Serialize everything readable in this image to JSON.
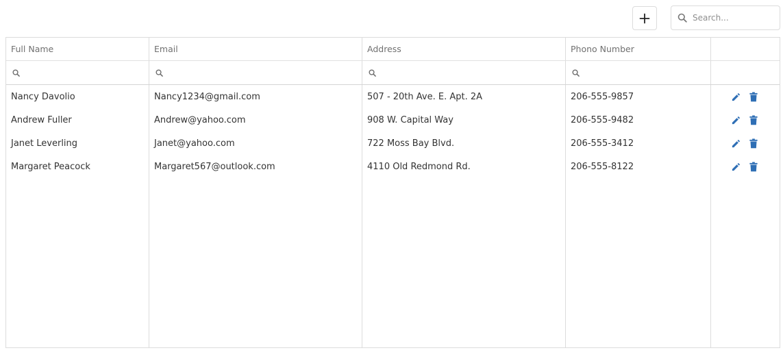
{
  "toolbar": {
    "add_icon": "plus-icon",
    "search_icon": "search-icon",
    "search_placeholder": "Search..."
  },
  "grid": {
    "columns": [
      "Full Name",
      "Email",
      "Address",
      "Phono Number",
      ""
    ],
    "filter_icon": "search-icon",
    "action_icons": [
      "edit-pencil-icon",
      "delete-trash-icon"
    ],
    "action_color": "#2f6fb5",
    "rows": [
      {
        "full_name": "Nancy Davolio",
        "email": "Nancy1234@gmail.com",
        "address": "507 - 20th Ave. E. Apt. 2A",
        "phone": "206-555-9857"
      },
      {
        "full_name": "Andrew Fuller",
        "email": "Andrew@yahoo.com",
        "address": "908 W. Capital Way",
        "phone": "206-555-9482"
      },
      {
        "full_name": "Janet Leverling",
        "email": "Janet@yahoo.com",
        "address": "722 Moss Bay Blvd.",
        "phone": "206-555-3412"
      },
      {
        "full_name": "Margaret Peacock",
        "email": "Margaret567@outlook.com",
        "address": "4110 Old Redmond Rd.",
        "phone": "206-555-8122"
      }
    ]
  }
}
